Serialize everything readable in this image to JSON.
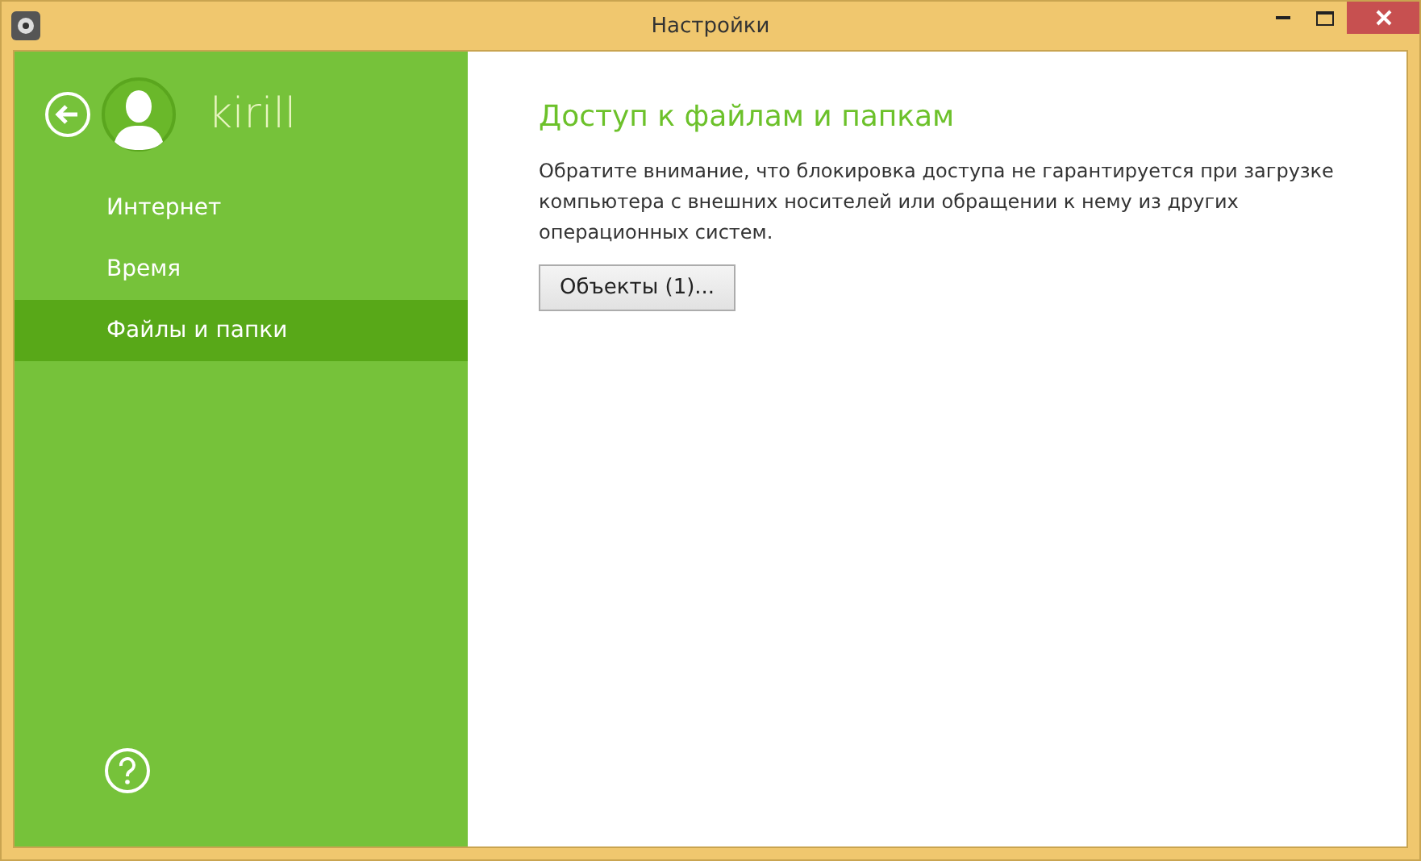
{
  "window": {
    "title": "Настройки"
  },
  "user": {
    "name": "kirill"
  },
  "nav": [
    {
      "label": "Интернет",
      "selected": false
    },
    {
      "label": "Время",
      "selected": false
    },
    {
      "label": "Файлы и папки",
      "selected": true
    }
  ],
  "content": {
    "heading": "Доступ к файлам и папкам",
    "note": "Обратите внимание, что блокировка доступа не гарантируется при загрузке компьютера с внешних носителей или обращении к нему из других операционных систем.",
    "button": "Объекты (1)..."
  }
}
